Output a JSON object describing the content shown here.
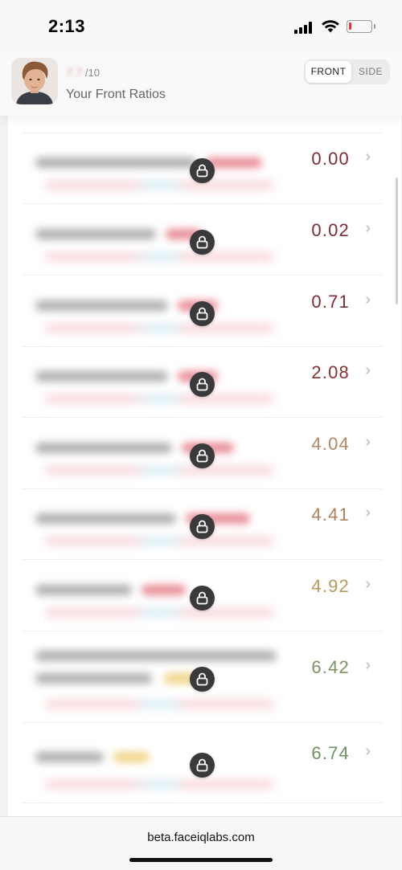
{
  "status": {
    "time": "2:13",
    "battery_level": 0.1
  },
  "header": {
    "score_value": "7.7",
    "score_suffix": "/10",
    "title": "Your Front Ratios",
    "toggle": {
      "front": "FRONT",
      "side": "SIDE",
      "selected": "FRONT"
    }
  },
  "colors": {
    "red": "#7d2b33",
    "orange": "#b58763",
    "gold": "#b99a5c",
    "green": "#6f9160"
  },
  "ratios": [
    {
      "value": "0.00",
      "color": "#7d2b33",
      "locked": true
    },
    {
      "value": "0.02",
      "color": "#7d2b33",
      "locked": true
    },
    {
      "value": "0.71",
      "color": "#7d2b33",
      "locked": true
    },
    {
      "value": "2.08",
      "color": "#8a3030",
      "locked": true
    },
    {
      "value": "4.04",
      "color": "#b58763",
      "locked": true
    },
    {
      "value": "4.41",
      "color": "#b08157",
      "locked": true
    },
    {
      "value": "4.92",
      "color": "#b99a5c",
      "locked": true
    },
    {
      "value": "6.42",
      "color": "#7a9464",
      "locked": true
    },
    {
      "value": "6.74",
      "color": "#6f9160",
      "locked": true
    }
  ],
  "browser": {
    "url": "beta.faceiqlabs.com"
  }
}
